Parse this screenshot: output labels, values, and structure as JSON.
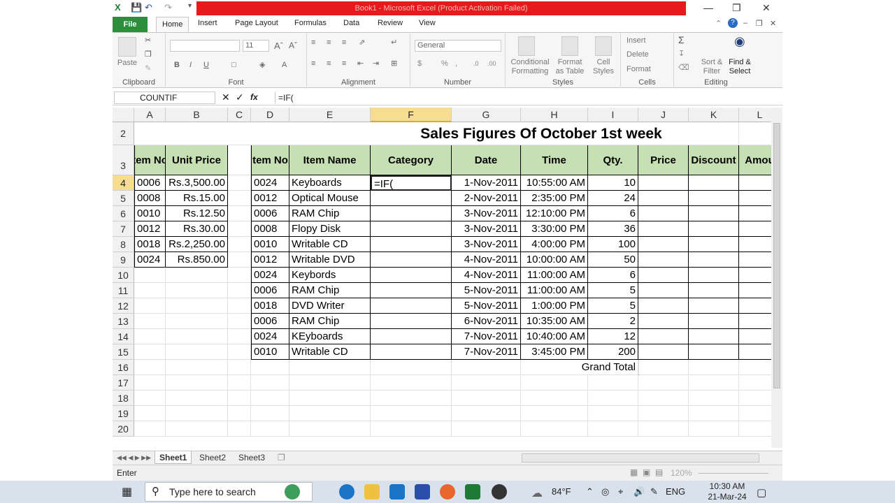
{
  "window": {
    "title": "Book1 - Microsoft Excel (Product Activation Failed)"
  },
  "ribbon_tabs": [
    "File",
    "Home",
    "Insert",
    "Page Layout",
    "Formulas",
    "Data",
    "Review",
    "View"
  ],
  "ribbon": {
    "clipboard": {
      "label": "Clipboard",
      "paste": "Paste"
    },
    "font": {
      "label": "Font",
      "size": "11"
    },
    "alignment": {
      "label": "Alignment"
    },
    "number": {
      "label": "Number",
      "format": "General"
    },
    "styles": {
      "label": "Styles",
      "conditional": "Conditional Formatting",
      "format_table": "Format as Table",
      "cell_styles": "Cell Styles"
    },
    "cells": {
      "label": "Cells",
      "insert": "Insert",
      "delete": "Delete",
      "format": "Format"
    },
    "editing": {
      "label": "Editing",
      "sort": "Sort & Filter",
      "find": "Find & Select"
    }
  },
  "formula_bar": {
    "name_box": "COUNTIF",
    "fx": "fx",
    "formula": "=IF("
  },
  "columns": [
    "A",
    "B",
    "C",
    "D",
    "E",
    "F",
    "G",
    "H",
    "I",
    "J",
    "K",
    "L"
  ],
  "rows": [
    "2",
    "3",
    "4",
    "5",
    "6",
    "7",
    "8",
    "9",
    "10",
    "11",
    "12",
    "13",
    "14",
    "15",
    "16",
    "17",
    "18",
    "19",
    "20"
  ],
  "sheet_title": "Sales Figures Of October 1st week",
  "price_table": {
    "headers": [
      "Item No.",
      "Unit Price"
    ],
    "rows": [
      [
        "0006",
        "Rs.3,500.00"
      ],
      [
        "0008",
        "Rs.15.00"
      ],
      [
        "0010",
        "Rs.12.50"
      ],
      [
        "0012",
        "Rs.30.00"
      ],
      [
        "0018",
        "Rs.2,250.00"
      ],
      [
        "0024",
        "Rs.850.00"
      ]
    ]
  },
  "sales_table": {
    "headers": [
      "Item No.",
      "Item Name",
      "Category",
      "Date",
      "Time",
      "Qty.",
      "Price",
      "Discount",
      "Amou"
    ],
    "rows": [
      [
        "0024",
        "Keyboards",
        "=IF(",
        "1-Nov-2011",
        "10:55:00 AM",
        "10"
      ],
      [
        "0012",
        "Optical Mouse",
        "",
        "2-Nov-2011",
        "2:35:00 PM",
        "24"
      ],
      [
        "0006",
        "RAM Chip",
        "",
        "3-Nov-2011",
        "12:10:00 PM",
        "6"
      ],
      [
        "0008",
        "Flopy Disk",
        "",
        "3-Nov-2011",
        "3:30:00 PM",
        "36"
      ],
      [
        "0010",
        "Writable CD",
        "",
        "3-Nov-2011",
        "4:00:00 PM",
        "100"
      ],
      [
        "0012",
        "Writable DVD",
        "",
        "4-Nov-2011",
        "10:00:00 AM",
        "50"
      ],
      [
        "0024",
        "Keybords",
        "",
        "4-Nov-2011",
        "11:00:00 AM",
        "6"
      ],
      [
        "0006",
        "RAM Chip",
        "",
        "5-Nov-2011",
        "11:00:00 AM",
        "5"
      ],
      [
        "0018",
        "DVD Writer",
        "",
        "5-Nov-2011",
        "1:00:00 PM",
        "5"
      ],
      [
        "0006",
        "RAM Chip",
        "",
        "6-Nov-2011",
        "10:35:00 AM",
        "2"
      ],
      [
        "0024",
        "KEyboards",
        "",
        "7-Nov-2011",
        "10:40:00 AM",
        "12"
      ],
      [
        "0010",
        "Writable CD",
        "",
        "7-Nov-2011",
        "3:45:00 PM",
        "200"
      ]
    ],
    "grand_total": "Grand Total"
  },
  "sheets": [
    "Sheet1",
    "Sheet2",
    "Sheet3"
  ],
  "status": {
    "mode": "Enter",
    "zoom": "120%"
  },
  "taskbar": {
    "search_placeholder": "Type here to search",
    "weather": "84°F",
    "lang": "ENG",
    "time": "10:30 AM",
    "date": "21-Mar-24"
  }
}
